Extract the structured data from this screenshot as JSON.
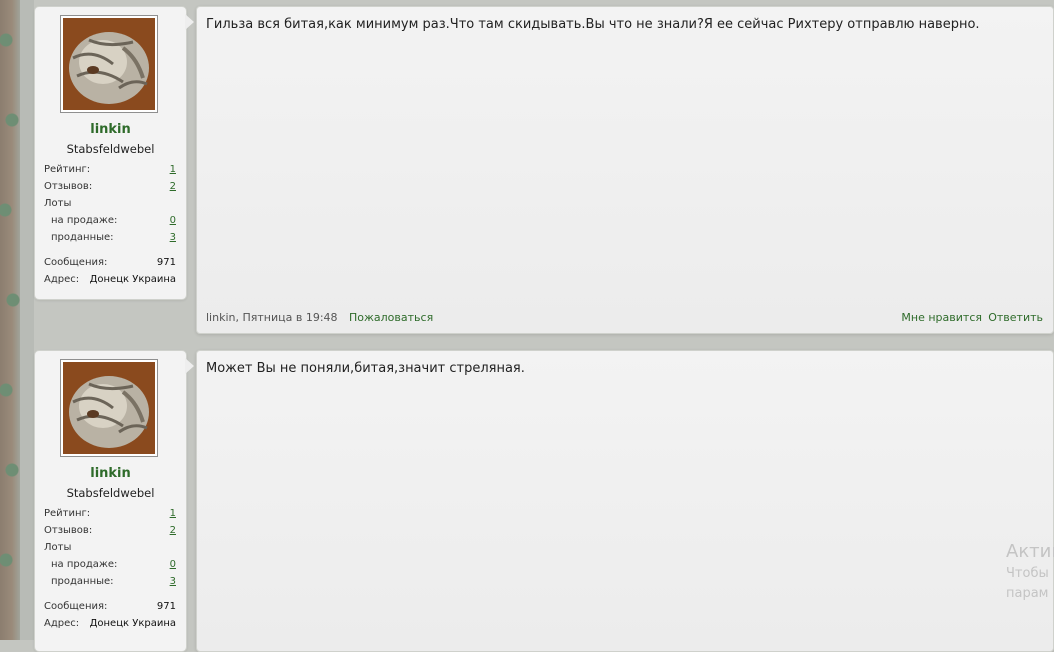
{
  "posts": [
    {
      "user": {
        "name": "linkin",
        "title": "Stabsfeldwebel",
        "stats": {
          "rating_label": "Рейтинг:",
          "rating_value": "1",
          "reviews_label": "Отзывов:",
          "reviews_value": "2",
          "lots_label": "Лоты",
          "on_sale_label": "на продаже:",
          "on_sale_value": "0",
          "sold_label": "проданные:",
          "sold_value": "3",
          "messages_label": "Сообщения:",
          "messages_value": "971",
          "address_label": "Адрес:",
          "address_value": "Донецк Украина"
        }
      },
      "text": "Гильза вся битая,как минимум раз.Что там скидывать.Вы что не знали?Я ее сейчас Рихтеру отправлю наверно.",
      "footer": {
        "author_time": "linkin, Пятница в 19:48",
        "report": "Пожаловаться",
        "like": "Мне нравится",
        "reply": "Ответить"
      }
    },
    {
      "user": {
        "name": "linkin",
        "title": "Stabsfeldwebel",
        "stats": {
          "rating_label": "Рейтинг:",
          "rating_value": "1",
          "reviews_label": "Отзывов:",
          "reviews_value": "2",
          "lots_label": "Лоты",
          "on_sale_label": "на продаже:",
          "on_sale_value": "0",
          "sold_label": "проданные:",
          "sold_value": "3",
          "messages_label": "Сообщения:",
          "messages_value": "971",
          "address_label": "Адрес:",
          "address_value": "Донецк Украина"
        }
      },
      "text": "Может Вы не поняли,битая,значит стреляная."
    }
  ],
  "watermark": {
    "line1": "Актив",
    "line2": "Чтобы",
    "line3": "парам"
  },
  "colors": {
    "link_green": "#2e6b2a",
    "background": "#c4c6c1"
  }
}
